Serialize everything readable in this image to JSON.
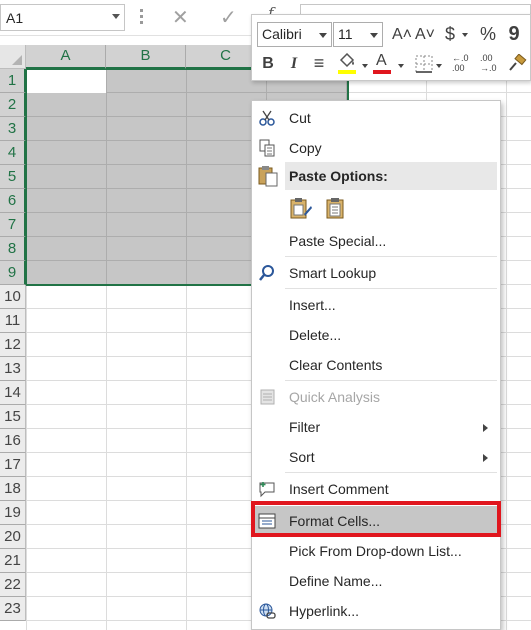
{
  "formula_bar": {
    "name_box": "A1",
    "cancel_glyph": "✕",
    "enter_glyph": "✓",
    "fx_label": "f",
    "formula": ""
  },
  "grid": {
    "columns": [
      "A",
      "B",
      "C"
    ],
    "rows": [
      "1",
      "2",
      "3",
      "4",
      "5",
      "6",
      "7",
      "8",
      "9",
      "10",
      "11",
      "12",
      "13",
      "14",
      "15",
      "16",
      "17",
      "18",
      "19",
      "20",
      "21",
      "22",
      "23"
    ],
    "selection": "A1:C9",
    "accent_color": "#217346"
  },
  "mini_toolbar": {
    "font_name": "Calibri",
    "font_size": "11",
    "increase_font": "A˄",
    "decrease_font": "A˅",
    "currency": "$",
    "percent": "%",
    "comma": "9",
    "bold": "B",
    "italic": "I",
    "align": "≡",
    "font_color_letter": "A",
    "fill_color": "#ffff00",
    "font_color": "#e0161e",
    "increase_decimal_top": "←.0",
    "increase_decimal_bottom": ".00",
    "decrease_decimal_top": ".00",
    "decrease_decimal_bottom": "→.0"
  },
  "context_menu": {
    "cut": "Cut",
    "copy": "Copy",
    "paste_options": "Paste Options:",
    "paste_special": "Paste Special...",
    "smart_lookup": "Smart Lookup",
    "insert": "Insert...",
    "delete": "Delete...",
    "clear_contents": "Clear Contents",
    "quick_analysis": "Quick Analysis",
    "filter": "Filter",
    "sort": "Sort",
    "insert_comment": "Insert Comment",
    "format_cells": "Format Cells...",
    "pick_from_list": "Pick From Drop-down List...",
    "define_name": "Define Name...",
    "hyperlink": "Hyperlink..."
  },
  "highlight_color": "#e0161e"
}
